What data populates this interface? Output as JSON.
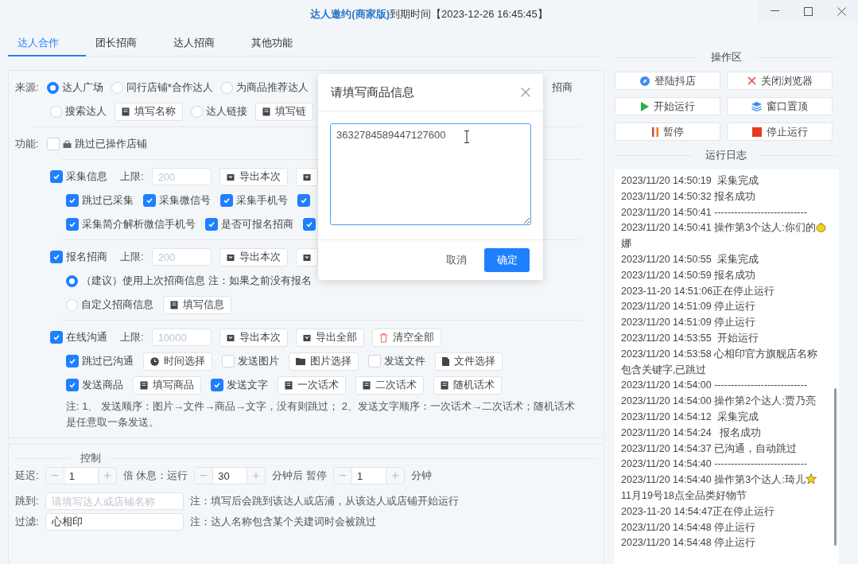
{
  "window": {
    "app_name": "达人邀约(商家版)",
    "expiry": "到期时间【2023-12-26 16:45:45】"
  },
  "tabs": [
    {
      "label": "达人合作",
      "selected": true
    },
    {
      "label": "团长招商",
      "selected": false
    },
    {
      "label": "达人招商",
      "selected": false
    },
    {
      "label": "其他功能",
      "selected": false
    }
  ],
  "source": {
    "label": "来源:",
    "lines": [
      {
        "items": [
          {
            "kind": "radio",
            "label": "达人广场",
            "selected": true
          },
          {
            "kind": "radio",
            "label": "同行店铺*合作达人",
            "selected": false
          },
          {
            "kind": "radio",
            "label": "为商品推荐达人",
            "selected": false
          },
          {
            "kind": "far",
            "label": "招商"
          }
        ]
      },
      {
        "items": [
          {
            "kind": "radio",
            "label": "搜索达人",
            "selected": false
          },
          {
            "kind": "write",
            "label": "填写名称"
          },
          {
            "kind": "radio",
            "label": "达人链接",
            "selected": false
          },
          {
            "kind": "write",
            "label": "填写链"
          }
        ]
      }
    ]
  },
  "features": {
    "label": "功能:",
    "skip": {
      "label": "跳过已操作店铺",
      "checked": false
    },
    "groups": [
      {
        "header": [
          {
            "kind": "checkbox",
            "label": "采集信息",
            "checked": true
          },
          {
            "kind": "text",
            "label": "上限:"
          },
          {
            "kind": "input",
            "placeholder": "200"
          },
          {
            "kind": "export",
            "label": "导出本次"
          },
          {
            "kind": "export"
          }
        ],
        "lines": [
          {
            "items": [
              {
                "kind": "checkbox",
                "label": "跳过已采集",
                "checked": true
              },
              {
                "kind": "checkbox",
                "label": "采集微信号",
                "checked": true
              },
              {
                "kind": "checkbox",
                "label": "采集手机号",
                "checked": true
              },
              {
                "kind": "checkbox",
                "checked": true
              }
            ]
          },
          {
            "items": [
              {
                "kind": "checkbox",
                "label": "采集简介解析微信手机号",
                "checked": true
              },
              {
                "kind": "checkbox",
                "label": "是否可报名招商",
                "checked": true
              },
              {
                "kind": "checkbox",
                "checked": true
              }
            ]
          }
        ]
      },
      {
        "header": [
          {
            "kind": "checkbox",
            "label": "报名招商",
            "checked": true
          },
          {
            "kind": "text",
            "label": "上限:"
          },
          {
            "kind": "input",
            "placeholder": "200"
          },
          {
            "kind": "export",
            "label": "导出本次"
          },
          {
            "kind": "export"
          }
        ],
        "lines": [
          {
            "items": [
              {
                "kind": "radio",
                "label": "（建议）使用上次招商信息 注：如果之前没有报名",
                "selected": true
              }
            ]
          },
          {
            "items": [
              {
                "kind": "radio",
                "label": "自定义招商信息",
                "selected": false
              },
              {
                "kind": "write",
                "label": "填写信息"
              }
            ]
          }
        ]
      },
      {
        "header": [
          {
            "kind": "checkbox",
            "label": "在线沟通",
            "checked": true
          },
          {
            "kind": "text",
            "label": "上限:"
          },
          {
            "kind": "input",
            "placeholder": "10000"
          },
          {
            "kind": "export",
            "label": "导出本次"
          },
          {
            "kind": "export",
            "label": "导出全部"
          },
          {
            "kind": "clear",
            "label": "清空全部"
          }
        ],
        "lines": [
          {
            "items": [
              {
                "kind": "checkbox",
                "label": "跳过已沟通",
                "checked": true
              },
              {
                "kind": "time",
                "label": "时间选择"
              },
              {
                "kind": "checkbox",
                "label": "发送图片",
                "checked": false
              },
              {
                "kind": "images",
                "label": "图片选择"
              },
              {
                "kind": "checkbox",
                "label": "发送文件",
                "checked": false
              },
              {
                "kind": "file",
                "label": "文件选择"
              }
            ]
          },
          {
            "items": [
              {
                "kind": "checkbox",
                "label": "发送商品",
                "checked": true
              },
              {
                "kind": "write",
                "label": "填写商品"
              },
              {
                "kind": "checkbox",
                "label": "发送文字",
                "checked": true
              },
              {
                "kind": "write",
                "label": "一次话术"
              },
              {
                "kind": "write",
                "label": "二次话术"
              },
              {
                "kind": "write",
                "label": "随机话术"
              }
            ]
          },
          {
            "items": [
              {
                "kind": "note",
                "label": "注: 1、 发送顺序：图片→文件→商品→文字，没有则跳过； 2、发送文字顺序：一次话术→二次话术；随机话术是任意取一条发送。"
              }
            ]
          }
        ]
      }
    ]
  },
  "control": {
    "title": "控制",
    "delay": {
      "label": "延迟:",
      "value": "1",
      "mid": "倍 休息：运行",
      "run": "30",
      "after": "分钟后 暂停",
      "pause": "1",
      "unit": "分钟"
    },
    "jump": {
      "label": "跳到:",
      "placeholder": "请填写达人或店铺名称",
      "note": "注：填写后会跳到该达人或店浦，从该达人或店铺开始运行"
    },
    "filter": {
      "label": "过滤:",
      "value": "心相印",
      "note": "注：达人名称包含某个关建词时会被跳过"
    }
  },
  "operations": {
    "title": "操作区",
    "buttons": [
      {
        "kind": "login",
        "label": "登陆抖店"
      },
      {
        "kind": "close",
        "label": "关闭浏览器"
      },
      {
        "kind": "start",
        "label": "开始运行"
      },
      {
        "kind": "pin",
        "label": "窗口置顶"
      },
      {
        "kind": "pause",
        "label": "暂停"
      },
      {
        "kind": "stop",
        "label": "停止运行"
      }
    ]
  },
  "log": {
    "title": "运行日志",
    "entries": [
      {
        "text": "2023/11/20 14:50:19  采集完成"
      },
      {
        "text": "2023/11/20 14:50:32 报名成功"
      },
      {
        "text": "2023/11/20 14:50:41 ----------------------------"
      },
      {
        "text": "2023/11/20 14:50:41 操作第3个达人:你们的",
        "kind": "fruit",
        "tail": "娜"
      },
      {
        "text": "2023/11/20 14:50:55  采集完成"
      },
      {
        "text": "2023/11/20 14:50:59 报名成功"
      },
      {
        "text": "2023-11-20 14:51:06正在停止运行"
      },
      {
        "text": "2023/11/20 14:51:09 停止运行"
      },
      {
        "text": "2023/11/20 14:51:09 停止运行"
      },
      {
        "text": "2023/11/20 14:53:55  开始运行"
      },
      {
        "text": "2023/11/20 14:53:58 心相印官方旗舰店名称包含关键字,已跳过"
      },
      {
        "text": "2023/11/20 14:54:00 ----------------------------"
      },
      {
        "text": "2023/11/20 14:54:00 操作第2个达人:贾乃亮"
      },
      {
        "text": "2023/11/20 14:54:12  采集完成"
      },
      {
        "text": "2023/11/20 14:54:24   报名成功"
      },
      {
        "text": "2023/11/20 14:54:37 已沟通，自动跳过"
      },
      {
        "text": "2023/11/20 14:54:40 ----------------------------"
      },
      {
        "text": "2023/11/20 14:54:40 操作第3个达人:琦儿",
        "kind": "star",
        "tail": "11月19号18点全品类好物节"
      },
      {
        "text": "2023-11-20 14:54:47正在停止运行"
      },
      {
        "text": "2023/11/20 14:54:48 停止运行"
      },
      {
        "text": "2023/11/20 14:54:48 停止运行"
      }
    ]
  },
  "dialog": {
    "title": "请填写商品信息",
    "value": "3632784589447127600",
    "cancel": "取消",
    "confirm": "确定"
  }
}
